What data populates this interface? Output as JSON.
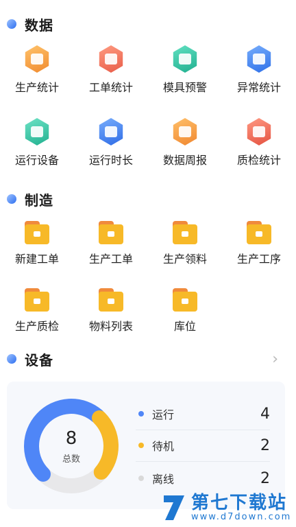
{
  "sections": {
    "data": {
      "title": "数据"
    },
    "manufacture": {
      "title": "制造"
    },
    "equipment": {
      "title": "设备"
    }
  },
  "data_items": [
    {
      "label": "生产统计",
      "icon": "production-stats-icon",
      "color": "#f6a33a"
    },
    {
      "label": "工单统计",
      "icon": "work-order-stats-icon",
      "color": "#f0735a"
    },
    {
      "label": "模具预警",
      "icon": "mold-warning-icon",
      "color": "#2fc3a4"
    },
    {
      "label": "异常统计",
      "icon": "exception-stats-icon",
      "color": "#3c86f2"
    },
    {
      "label": "运行设备",
      "icon": "running-equipment-icon",
      "color": "#35c6a8"
    },
    {
      "label": "运行时长",
      "icon": "running-duration-icon",
      "color": "#3d82f0"
    },
    {
      "label": "数据周报",
      "icon": "weekly-report-icon",
      "color": "#f59c3d"
    },
    {
      "label": "质检统计",
      "icon": "quality-stats-icon",
      "color": "#ef6650"
    }
  ],
  "manufacture_items": [
    {
      "label": "新建工单",
      "icon": "new-work-order-icon"
    },
    {
      "label": "生产工单",
      "icon": "production-work-order-icon"
    },
    {
      "label": "生产领料",
      "icon": "material-pick-icon"
    },
    {
      "label": "生产工序",
      "icon": "production-process-icon"
    },
    {
      "label": "生产质检",
      "icon": "production-inspection-icon"
    },
    {
      "label": "物料列表",
      "icon": "material-list-icon"
    },
    {
      "label": "库位",
      "icon": "storage-location-icon"
    }
  ],
  "equipment": {
    "total_value": "8",
    "total_label": "总数",
    "legend": [
      {
        "label": "运行",
        "value": "4",
        "color": "#4f86f7"
      },
      {
        "label": "待机",
        "value": "2",
        "color": "#f7b928"
      },
      {
        "label": "离线",
        "value": "2",
        "color": "#d9d9d9"
      }
    ],
    "chevron_icon": "chevron-right-icon"
  },
  "watermark": {
    "title": "第七下载站",
    "url": "www.d7down.com"
  },
  "colors": {
    "folder_front": "#f7b928",
    "folder_back": "#f08a3c",
    "primary": "#3c7cf0"
  }
}
